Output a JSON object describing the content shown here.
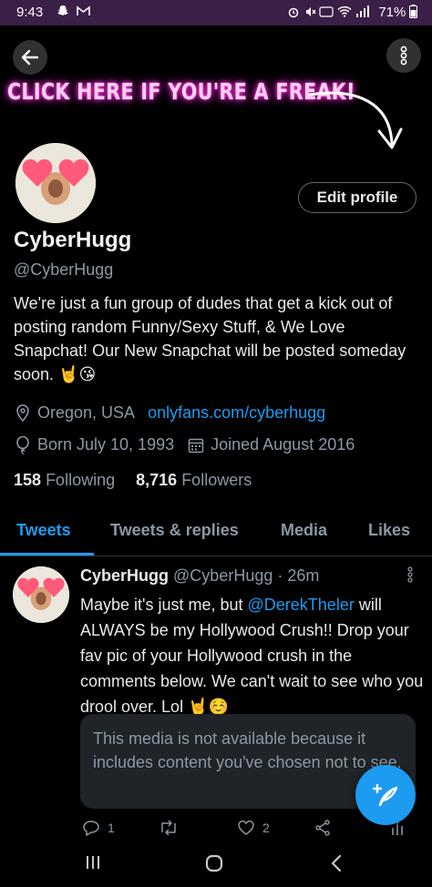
{
  "status_bar": {
    "time": "9:43",
    "battery": "71%"
  },
  "banner": {
    "text": "CLICK HERE IF YOU'RE A FREAK!"
  },
  "profile": {
    "edit_label": "Edit profile",
    "display_name": "CyberHugg",
    "handle": "@CyberHugg",
    "bio": "We're just a fun group of dudes that get a kick out of posting random Funny/Sexy Stuff, & We Love Snapchat!  Our New Snapchat will be posted someday soon. 🤘😘",
    "location": "Oregon, USA",
    "website": "onlyfans.com/cyberhugg",
    "born": "Born July 10, 1993",
    "joined": "Joined August 2016",
    "following_count": "158",
    "following_label": "Following",
    "followers_count": "8,716",
    "followers_label": "Followers"
  },
  "tabs": [
    "Tweets",
    "Tweets & replies",
    "Media",
    "Likes"
  ],
  "tweet": {
    "name": "CyberHugg",
    "handle_time": "@CyberHugg · 26m",
    "text_before": "Maybe it's just me, but ",
    "mention": "@DerekTheler",
    "text_after": " will ALWAYS be my Hollywood Crush!! Drop your fav pic of your Hollywood crush in the comments below. We can't wait to see who you drool over. Lol 🤘☺️",
    "media_notice": "This media is not available because it includes content you've chosen not to see.",
    "reply_count": "1",
    "like_count": "2"
  },
  "colors": {
    "accent": "#1d9bf0",
    "status_bar": "#3a1f47",
    "neon": "#ff2fd1"
  }
}
